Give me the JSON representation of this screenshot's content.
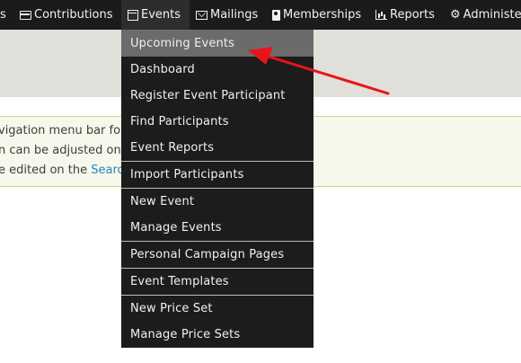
{
  "navbar": {
    "items": [
      {
        "label": "s",
        "icon": ""
      },
      {
        "label": "Contributions",
        "icon": "credit-card-icon"
      },
      {
        "label": "Events",
        "icon": "calendar-icon"
      },
      {
        "label": "Mailings",
        "icon": "envelope-icon"
      },
      {
        "label": "Memberships",
        "icon": "id-badge-icon"
      },
      {
        "label": "Reports",
        "icon": "bar-chart-icon"
      },
      {
        "label": "Administe",
        "icon": "gears-icon"
      }
    ]
  },
  "help": {
    "line1": "vigation menu bar for",
    "line2": "n can be adjusted on",
    "line3_text": "e edited on the ",
    "line3_link": "Searc"
  },
  "dropdown": {
    "items": [
      {
        "label": "Upcoming Events"
      },
      {
        "label": "Dashboard"
      },
      {
        "label": "Register Event Participant"
      },
      {
        "label": "Find Participants"
      },
      {
        "label": "Event Reports"
      },
      {
        "label": "Import Participants"
      },
      {
        "label": "New Event"
      },
      {
        "label": "Manage Events"
      },
      {
        "label": "Personal Campaign Pages"
      },
      {
        "label": "Event Templates"
      },
      {
        "label": "New Price Set"
      },
      {
        "label": "Manage Price Sets"
      }
    ]
  },
  "colors": {
    "navbar_bg": "#1b1b1b",
    "dropdown_bg": "#1c1c1c",
    "highlight_bg": "#6b6b6b",
    "grey_band": "#e0dfd9",
    "help_bg": "#f5f8eb",
    "help_border": "#c9d98f",
    "link": "#2786c2",
    "arrow": "#e8141c"
  }
}
